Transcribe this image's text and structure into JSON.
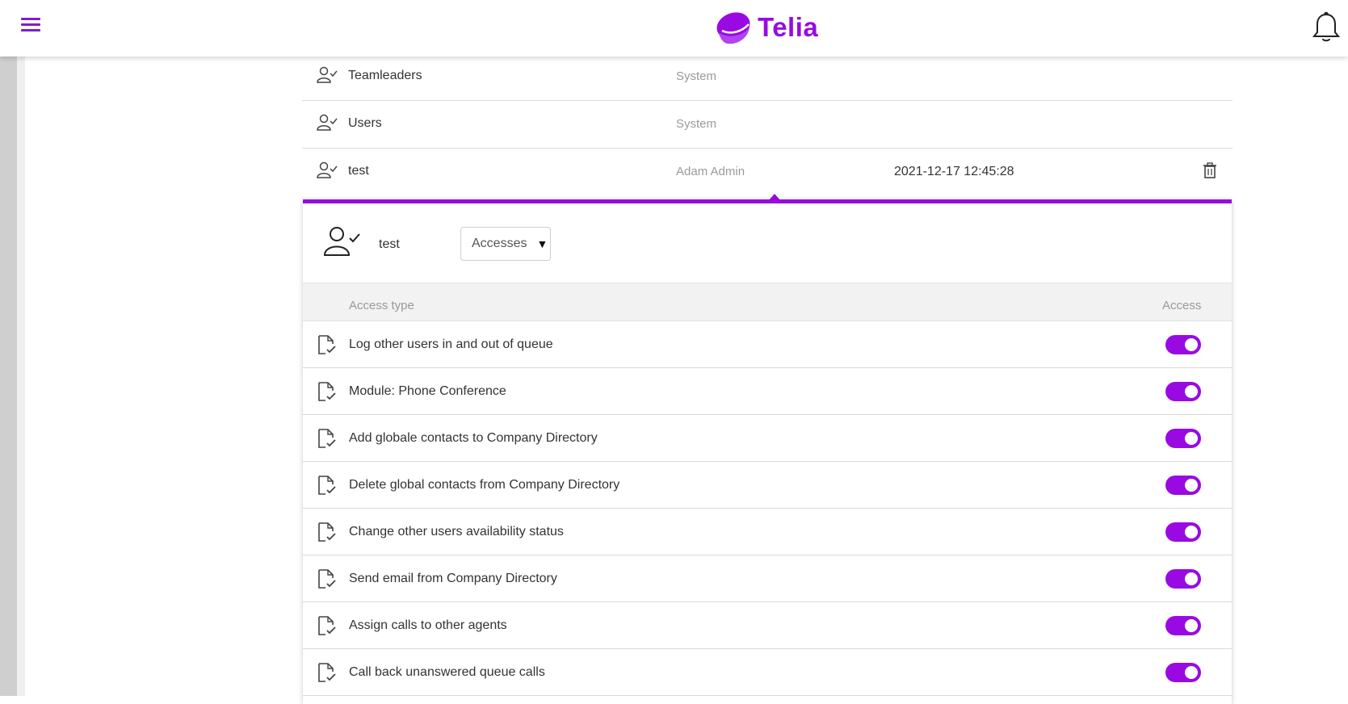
{
  "brand": {
    "name": "Telia",
    "color": "#990ae3"
  },
  "header": {
    "menu_icon": "hamburger-icon",
    "notification_icon": "bell-icon"
  },
  "groups": [
    {
      "name": "Teamleaders",
      "created_by": "System",
      "date": ""
    },
    {
      "name": "Users",
      "created_by": "System",
      "date": ""
    },
    {
      "name": "test",
      "created_by": "Adam Admin",
      "date": "2021-12-17 12:45:28"
    }
  ],
  "panel": {
    "name": "test",
    "select": {
      "value": "Accesses"
    },
    "columns": {
      "type": "Access type",
      "access": "Access"
    },
    "rows": [
      {
        "label": "Log other users in and out of queue",
        "enabled": true
      },
      {
        "label": "Module: Phone Conference",
        "enabled": true
      },
      {
        "label": "Add globale contacts to Company Directory",
        "enabled": true
      },
      {
        "label": "Delete global contacts from Company Directory",
        "enabled": true
      },
      {
        "label": "Change other users availability status",
        "enabled": true
      },
      {
        "label": "Send email from Company Directory",
        "enabled": true
      },
      {
        "label": "Assign calls to other agents",
        "enabled": true
      },
      {
        "label": "Call back unanswered queue calls",
        "enabled": true
      }
    ]
  }
}
